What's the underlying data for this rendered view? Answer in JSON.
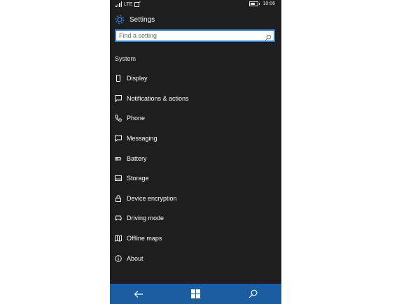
{
  "status_bar": {
    "network": "LTE",
    "time": "10:06",
    "battery_level": 0.6
  },
  "header": {
    "title": "Settings",
    "icon": "gear-icon"
  },
  "search": {
    "placeholder": "Find a setting",
    "value": ""
  },
  "section": {
    "label": "System"
  },
  "menu": {
    "items": [
      {
        "label": "Display",
        "icon": "display-icon"
      },
      {
        "label": "Notifications & actions",
        "icon": "notification-icon"
      },
      {
        "label": "Phone",
        "icon": "phone-icon"
      },
      {
        "label": "Messaging",
        "icon": "message-icon"
      },
      {
        "label": "Battery",
        "icon": "battery-icon"
      },
      {
        "label": "Storage",
        "icon": "storage-icon"
      },
      {
        "label": "Device encryption",
        "icon": "lock-icon"
      },
      {
        "label": "Driving mode",
        "icon": "car-icon"
      },
      {
        "label": "Offline maps",
        "icon": "map-icon"
      },
      {
        "label": "About",
        "icon": "info-icon"
      }
    ]
  },
  "nav_bar": {
    "buttons": [
      "back-arrow-icon",
      "windows-logo-icon",
      "search-icon"
    ]
  },
  "colors": {
    "background": "#1e1e1e",
    "accent": "#2d7fd3",
    "nav_bar": "#1a5da0",
    "text": "#ffffff"
  }
}
